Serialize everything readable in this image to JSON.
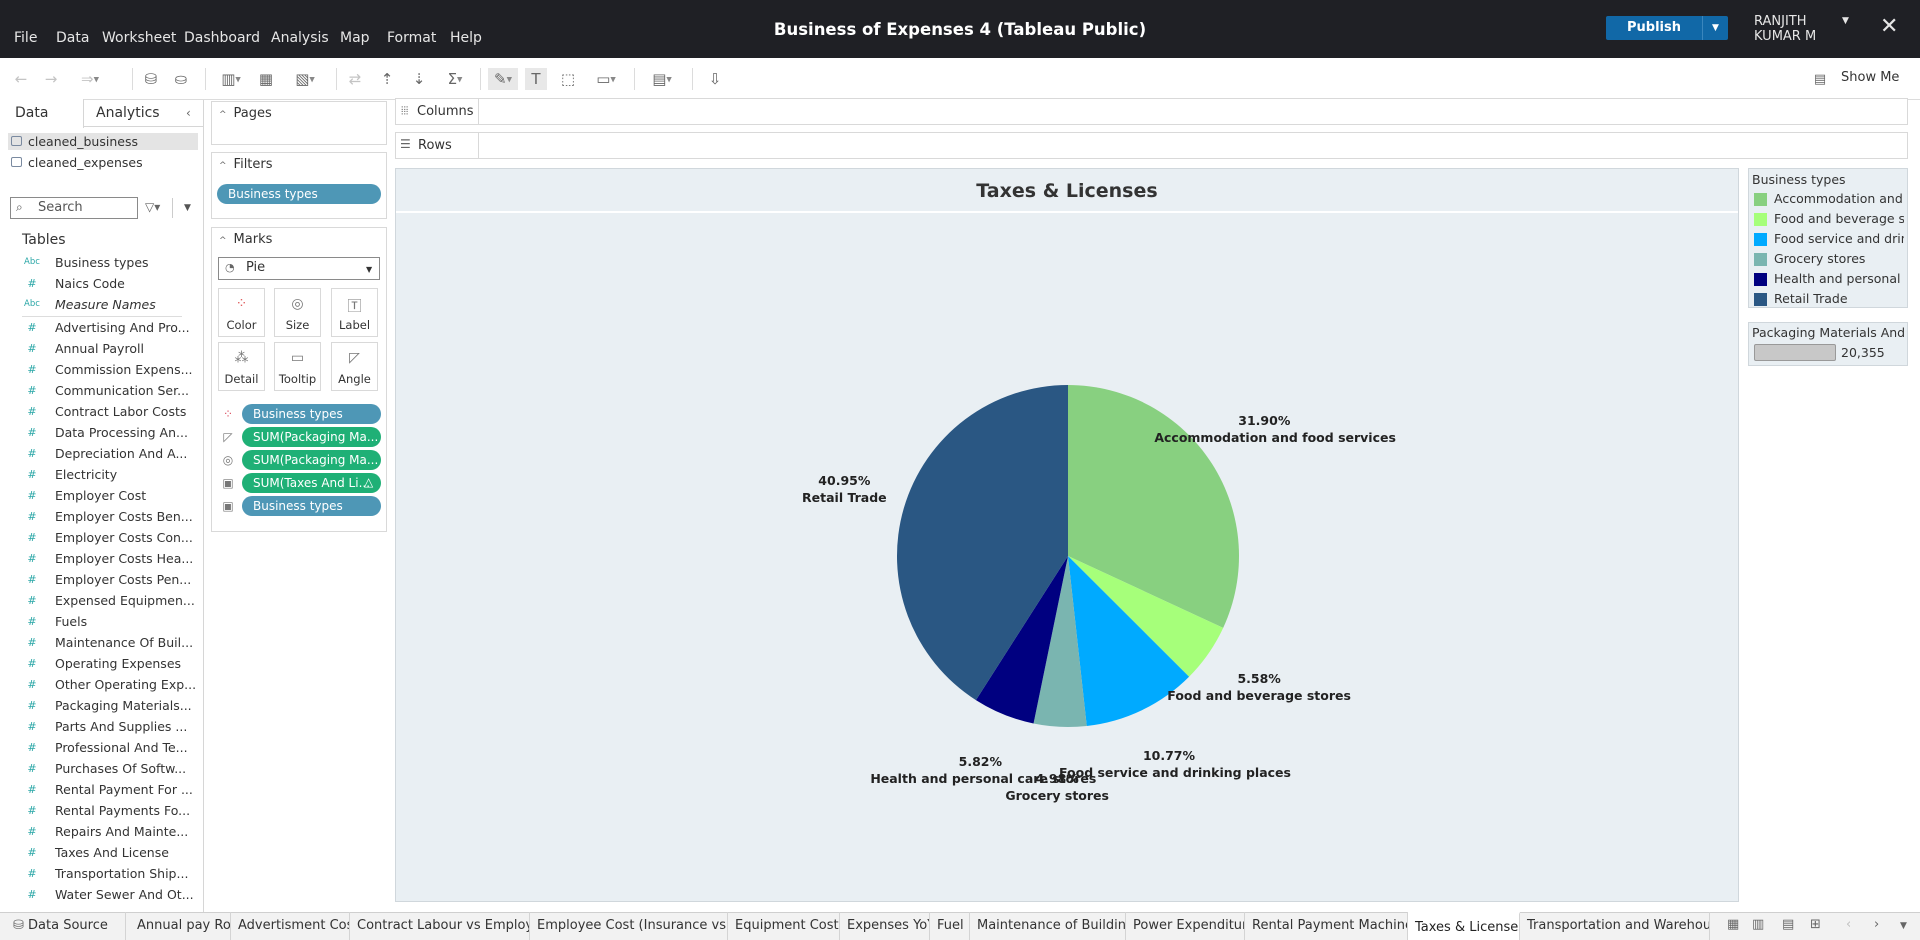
{
  "menu": [
    "File",
    "Data",
    "Worksheet",
    "Dashboard",
    "Analysis",
    "Map",
    "Format",
    "Help"
  ],
  "window": {
    "title": "Business of Expenses 4 (Tableau Public)"
  },
  "publish": {
    "label": "Publish"
  },
  "user": {
    "line1": "RANJITH",
    "line2": "KUMAR M"
  },
  "toolbar": {
    "show_me": "Show Me"
  },
  "left_pane": {
    "tabs": [
      "Data",
      "Analytics"
    ],
    "data_sources": [
      "cleaned_business",
      "cleaned_expenses"
    ],
    "search_placeholder": "Search",
    "tables_label": "Tables",
    "dimensions": [
      {
        "type": "Abc",
        "name": "Business types"
      },
      {
        "type": "#",
        "name": "Naics Code"
      },
      {
        "type": "Abc",
        "name": "Measure Names"
      }
    ],
    "measures": [
      "Advertising And Pro...",
      "Annual Payroll",
      "Commission Expens...",
      "Communication Ser...",
      "Contract Labor Costs",
      "Data Processing An...",
      "Depreciation And A...",
      "Electricity",
      "Employer Cost",
      "Employer Costs Ben...",
      "Employer Costs Con...",
      "Employer Costs Hea...",
      "Employer Costs Pen...",
      "Expensed Equipmen...",
      "Fuels",
      "Maintenance Of Buil...",
      "Operating Expenses",
      "Other Operating Exp...",
      "Packaging Materials...",
      "Parts And Supplies ...",
      "Professional And Te...",
      "Purchases Of Softw...",
      "Rental Payment For ...",
      "Rental Payments Fo...",
      "Repairs And Mainte...",
      "Taxes And License",
      "Transportation Ship...",
      "Water Sewer And Ot..."
    ]
  },
  "cards": {
    "pages": "Pages",
    "filters": "Filters",
    "filter_pills": [
      "Business types"
    ],
    "marks": "Marks",
    "mark_type": "Pie",
    "mark_buttons": [
      "Color",
      "Size",
      "Label",
      "Detail",
      "Tooltip",
      "Angle"
    ],
    "mark_pills": [
      {
        "icon": "color-icon",
        "label": "Business types",
        "color": "blue"
      },
      {
        "icon": "angle-icon",
        "label": "SUM(Packaging Ma...",
        "color": "green"
      },
      {
        "icon": "size-icon",
        "label": "SUM(Packaging Ma...",
        "color": "green"
      },
      {
        "icon": "label-icon",
        "label": "SUM(Taxes And Li...",
        "color": "green",
        "delta": "△"
      },
      {
        "icon": "label-icon",
        "label": "Business types",
        "color": "blue"
      }
    ]
  },
  "shelves": {
    "columns": "Columns",
    "rows": "Rows"
  },
  "view": {
    "title": "Taxes & Licenses"
  },
  "chart_data": {
    "type": "pie",
    "title": "Taxes & Licenses",
    "slices": [
      {
        "label": "Accommodation and food services",
        "percent": "31.90%",
        "value": 31.9,
        "color": "#88d080"
      },
      {
        "label": "Food and beverage stores",
        "percent": "5.58%",
        "value": 5.58,
        "color": "#a6ff7a"
      },
      {
        "label": "Food service and drinking places",
        "percent": "10.77%",
        "value": 10.77,
        "color": "#00aaff"
      },
      {
        "label": "Grocery stores",
        "percent": "4.98%",
        "value": 4.98,
        "color": "#7ab5b0"
      },
      {
        "label": "Health and personal care stores",
        "percent": "5.82%",
        "value": 5.82,
        "color": "#000080"
      },
      {
        "label": "Retail Trade",
        "percent": "40.95%",
        "value": 40.95,
        "color": "#2a5783"
      }
    ]
  },
  "legend": {
    "title": "Business types",
    "items": [
      {
        "label": "Accommodation and ...",
        "color": "#88d080"
      },
      {
        "label": "Food and beverage st...",
        "color": "#a6ff7a"
      },
      {
        "label": "Food service and drin...",
        "color": "#00aaff"
      },
      {
        "label": "Grocery stores",
        "color": "#7ab5b0"
      },
      {
        "label": "Health and personal ...",
        "color": "#000080"
      },
      {
        "label": "Retail Trade",
        "color": "#2a5783"
      }
    ]
  },
  "size_legend": {
    "title": "Packaging Materials And ...",
    "value": "20,355"
  },
  "sheet_tabs": {
    "data_source": "Data Source",
    "tabs": [
      "Annual pay Roll",
      "Advertisment Cost",
      "Contract Labour vs Employee",
      "Employee Cost (Insurance vs P...",
      "Equipment Costs",
      "Expenses YoY",
      "Fuel",
      "Maintenance of Buildings",
      "Power Expenditure",
      "Rental Payment Machinery",
      "Taxes & Licenses",
      "Transportation and Warehousing"
    ],
    "active": "Taxes & Licenses"
  }
}
